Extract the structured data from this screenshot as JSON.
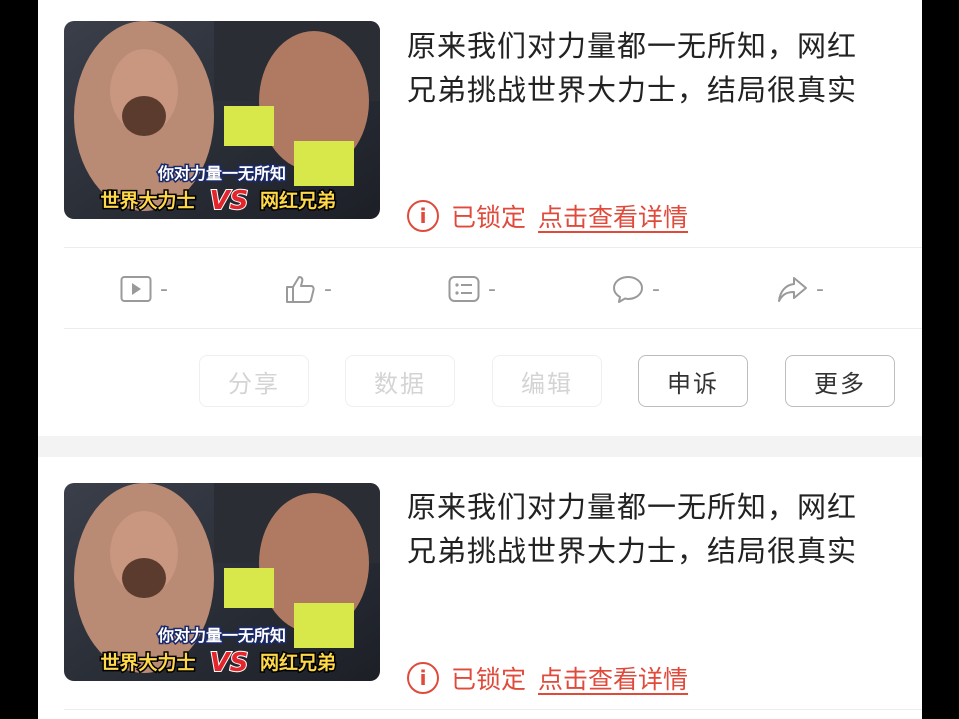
{
  "posts": [
    {
      "title_line1": "原来我们对力量都一无所知，网红",
      "title_line2": "兄弟挑战世界大力士，结局很真实",
      "thumb_caption": "你对力量一无所知",
      "thumb_left_label": "世界大力士",
      "thumb_vs": "VS",
      "thumb_right_label": "网红兄弟",
      "status_icon": "info-circle-icon",
      "status_text": "已锁定",
      "detail_link": "点击查看详情"
    },
    {
      "title_line1": "原来我们对力量都一无所知，网红",
      "title_line2": "兄弟挑战世界大力士，结局很真实",
      "thumb_caption": "你对力量一无所知",
      "thumb_left_label": "世界大力士",
      "thumb_vs": "VS",
      "thumb_right_label": "网红兄弟",
      "status_icon": "info-circle-icon",
      "status_text": "已锁定",
      "detail_link": "点击查看详情"
    }
  ],
  "stats": [
    {
      "icon": "play-icon",
      "value": "-"
    },
    {
      "icon": "thumbs-up-icon",
      "value": "-"
    },
    {
      "icon": "list-icon",
      "value": "-"
    },
    {
      "icon": "comment-icon",
      "value": "-"
    },
    {
      "icon": "share-icon",
      "value": "-"
    }
  ],
  "actions": [
    {
      "label": "分享",
      "enabled": false
    },
    {
      "label": "数据",
      "enabled": false
    },
    {
      "label": "编辑",
      "enabled": false
    },
    {
      "label": "申诉",
      "enabled": true
    },
    {
      "label": "更多",
      "enabled": true
    }
  ],
  "colors": {
    "locked_red": "#e04a3b",
    "muted_gray": "#9a9a9a",
    "thumb_yellow": "#ffd84a",
    "thumb_red": "#e4252b"
  }
}
